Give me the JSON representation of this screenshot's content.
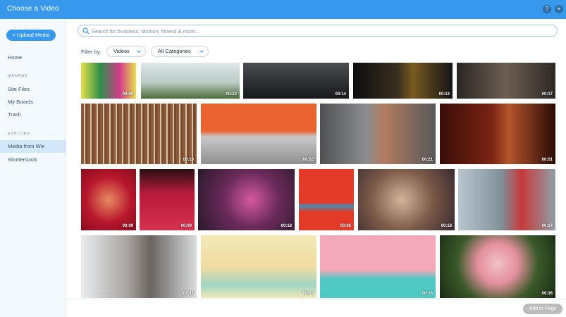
{
  "window": {
    "title": "Choose a Video",
    "help_label": "?",
    "close_label": "×"
  },
  "sidebar": {
    "upload_label": "+ Upload Media",
    "home": "Home",
    "manage_heading": "MANAGE",
    "manage_items": [
      "Site Files",
      "My Boards",
      "Trash"
    ],
    "explore_heading": "EXPLORE",
    "explore_items": [
      "Media from Wix",
      "Shutterstock"
    ],
    "active_item": "Media from Wix"
  },
  "search": {
    "placeholder": "Search for business, fashion, fitness & more..."
  },
  "filters": {
    "label": "Filter by:",
    "type_value": "Videos",
    "category_value": "All Categories"
  },
  "videos": [
    {
      "duration": "00:09",
      "bg": "linear-gradient(90deg,#e8e14a 0%,#2c8f4a 35%,#d23a8c 70%,#e8e14a 100%)"
    },
    {
      "duration": "00:22",
      "bg": "linear-gradient(180deg,#dfe7ea 0%,#b9cbc4 55%,#4d6e3a 100%)"
    },
    {
      "duration": "00:14",
      "bg": "linear-gradient(180deg,#4c4e52 0%,#2b2d31 60%,#1a1a1c 100%)"
    },
    {
      "duration": "00:13",
      "bg": "linear-gradient(90deg,#0d0d0d 0%,#3a3020 45%,#7a5a20 60%,#141414 100%)"
    },
    {
      "duration": "00:17",
      "bg": "linear-gradient(90deg,#2a2623 0%,#6d5e52 50%,#2d2824 100%)"
    },
    {
      "duration": "00:10",
      "bg": "repeating-linear-gradient(90deg,#8a5a3a 0 4px,#d9c3a6 4px 6px,#7a4a2c 6px 9px)"
    },
    {
      "duration": "00:02",
      "bg": "linear-gradient(180deg,#e9622e 0%,#e9622e 45%,#c9c9c9 55%,#8f8f8f 100%)"
    },
    {
      "duration": "00:21",
      "bg": "linear-gradient(90deg,#4f5052 0%,#8b8d90 40%,#b37c5e 55%,#57585a 100%)"
    },
    {
      "duration": "00:01",
      "bg": "linear-gradient(90deg,#3a0d08 0%,#7a2312 45%,#b3552a 60%,#2a0a06 100%)"
    },
    {
      "duration": "00:09",
      "bg": "radial-gradient(circle at 50% 50%,#e88a63 0%,#b8172c 55%,#8a0c1e 100%)"
    },
    {
      "duration": "00:09",
      "bg": "linear-gradient(180deg,#2a1014 0%,#b81a3a 40%,#d6324f 100%)"
    },
    {
      "duration": "00:18",
      "bg": "radial-gradient(circle at 55% 50%,#d45aa0 0%,#6a2a5a 45%,#2a1a2c 100%)"
    },
    {
      "duration": "00:06",
      "bg": "linear-gradient(180deg,#e33b28 0%,#e33b28 55%,#3f8fb8 60%,#e33b28 70%)"
    },
    {
      "duration": "00:18",
      "bg": "radial-gradient(circle at 45% 50%,#d3b49a 0%,#7b5a48 50%,#3a2a30 100%)"
    },
    {
      "duration": "00:14",
      "bg": "linear-gradient(90deg,#b9c6cf 0%,#7f8f98 45%,#c73a3a 65%,#8fa0a8 100%)"
    },
    {
      "duration": "00:11",
      "bg": "linear-gradient(90deg,#e9ecef 0%,#a9a4a0 40%,#6a6460 60%,#d9dcdf 100%)"
    },
    {
      "duration": "00:10",
      "bg": "linear-gradient(180deg,#f3e9b6 0%,#f0dca0 50%,#9fd6c3 80%,#f3e9b6 100%)"
    },
    {
      "duration": "00:16",
      "bg": "linear-gradient(180deg,#f4a9b8 0%,#f4a9b8 55%,#4fc9c4 70%,#4fc9c4 100%)"
    },
    {
      "duration": "00:36",
      "bg": "radial-gradient(circle at 50% 45%,#f3c3c8 0%,#e38f9c 30%,#3a5a2a 60%,#1a2a14 100%)"
    }
  ],
  "footer": {
    "add_label": "Add to Page"
  }
}
